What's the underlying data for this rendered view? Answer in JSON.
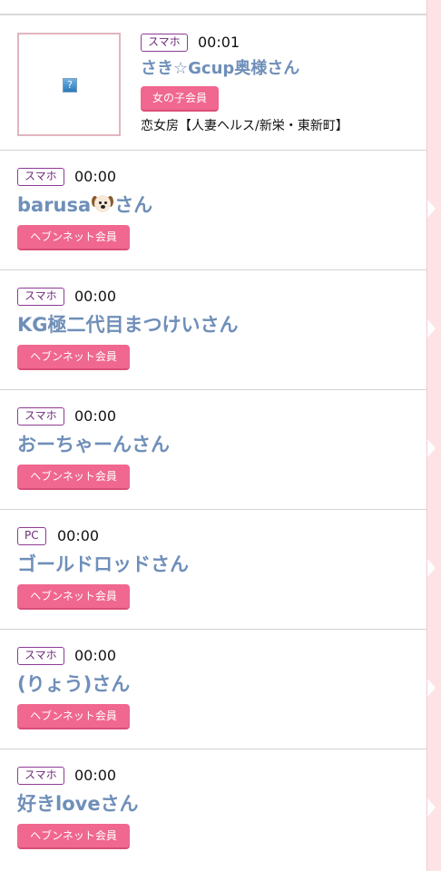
{
  "entries": [
    {
      "device": "スマホ",
      "time": "00:01",
      "name": "さき☆Gcup奥様さん",
      "member_type": "女の子会員",
      "shop": "恋女房【人妻ヘルス/新栄・東新町】",
      "thumbnail_placeholder": "?"
    },
    {
      "device": "スマホ",
      "time": "00:00",
      "name_prefix": "barusa",
      "name_emoji": "dog-face",
      "name_suffix": "さん",
      "member_type": "ヘブンネット会員"
    },
    {
      "device": "スマホ",
      "time": "00:00",
      "name": "KG極二代目まつけいさん",
      "member_type": "ヘブンネット会員"
    },
    {
      "device": "スマホ",
      "time": "00:00",
      "name": "おーちゃーんさん",
      "member_type": "ヘブンネット会員"
    },
    {
      "device": "PC",
      "time": "00:00",
      "name": "ゴールドロッドさん",
      "member_type": "ヘブンネット会員"
    },
    {
      "device": "スマホ",
      "time": "00:00",
      "name": "(りょう)さん",
      "member_type": "ヘブンネット会員"
    },
    {
      "device": "スマホ",
      "time": "00:00",
      "name": "好きloveさん",
      "member_type": "ヘブンネット会員"
    }
  ],
  "colors": {
    "name_link": "#6f8fb9",
    "member_badge": "#f0678f",
    "device_border": "#8e3a96",
    "side_strip": "#fde3e6"
  }
}
